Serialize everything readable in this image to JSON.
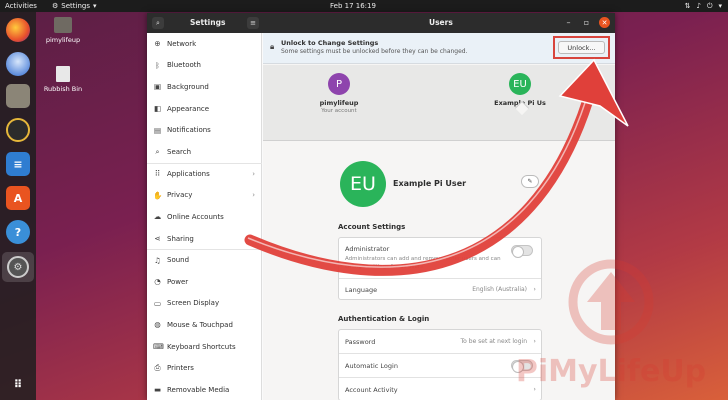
{
  "topbar": {
    "activities": "Activities",
    "app_menu": "Settings",
    "clock": "Feb 17  16:19"
  },
  "desktop": {
    "icons": [
      {
        "label": "pimylifeup"
      },
      {
        "label": "Rubbish Bin"
      }
    ]
  },
  "dock": {
    "items": [
      "firefox-icon",
      "thunderbird-icon",
      "files-icon",
      "rhythmbox-icon",
      "writer-icon",
      "software-icon",
      "help-icon",
      "settings-icon",
      "show-apps-icon"
    ]
  },
  "window": {
    "settings_title": "Settings",
    "users_title": "Users"
  },
  "sidebar": {
    "items": [
      {
        "label": "Network",
        "icon": "network-icon"
      },
      {
        "label": "Bluetooth",
        "icon": "bluetooth-icon"
      },
      {
        "label": "Background",
        "icon": "background-icon"
      },
      {
        "label": "Appearance",
        "icon": "appearance-icon"
      },
      {
        "label": "Notifications",
        "icon": "notifications-icon"
      },
      {
        "label": "Search",
        "icon": "search-icon"
      },
      {
        "label": "Applications",
        "icon": "applications-icon",
        "chevron": true
      },
      {
        "label": "Privacy",
        "icon": "privacy-icon",
        "chevron": true
      },
      {
        "label": "Online Accounts",
        "icon": "online-accounts-icon"
      },
      {
        "label": "Sharing",
        "icon": "sharing-icon"
      },
      {
        "label": "Sound",
        "icon": "sound-icon"
      },
      {
        "label": "Power",
        "icon": "power-icon"
      },
      {
        "label": "Screen Display",
        "icon": "display-icon"
      },
      {
        "label": "Mouse & Touchpad",
        "icon": "mouse-icon"
      },
      {
        "label": "Keyboard Shortcuts",
        "icon": "keyboard-icon"
      },
      {
        "label": "Printers",
        "icon": "printer-icon"
      },
      {
        "label": "Removable Media",
        "icon": "media-icon"
      }
    ]
  },
  "infobar": {
    "title": "Unlock to Change Settings",
    "subtitle": "Some settings must be unlocked before they can be changed.",
    "unlock_label": "Unlock..."
  },
  "users": [
    {
      "initial": "P",
      "name": "pimylifeup",
      "sub": "Your account",
      "color": "#8e44ad"
    },
    {
      "initial": "EU",
      "name": "Example Pi Us",
      "sub": "",
      "color": "#2ab45a"
    }
  ],
  "profile": {
    "initials": "EU",
    "full_name": "Example Pi User",
    "avatar_color": "#2ab45a"
  },
  "account_settings": {
    "heading": "Account Settings",
    "administrator_label": "Administrator",
    "administrator_desc": "Administrators can add and remove other users and can change settings for all users",
    "language_label": "Language",
    "language_value": "English (Australia)"
  },
  "auth": {
    "heading": "Authentication & Login",
    "password_label": "Password",
    "password_value": "To be set at next login",
    "auto_login_label": "Automatic Login",
    "activity_label": "Account Activity"
  },
  "watermark": {
    "text": "PiMyLifeUp"
  },
  "colors": {
    "accent": "#e95420",
    "highlight": "#d8453d",
    "arrow": "#e0403a"
  }
}
